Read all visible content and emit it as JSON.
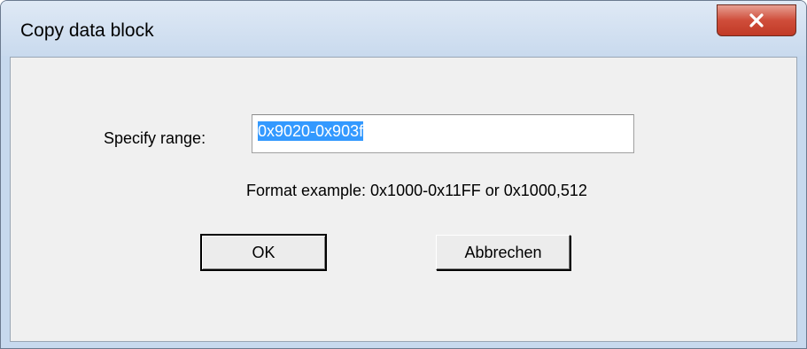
{
  "window": {
    "title": "Copy data block",
    "close_icon": "close-icon"
  },
  "form": {
    "range_label": "Specify range:",
    "range_value": "0x9020-0x903f",
    "format_example": "Format example: 0x1000-0x11FF or 0x1000,512"
  },
  "buttons": {
    "ok_label": "OK",
    "cancel_label": "Abbrechen"
  },
  "colors": {
    "selection": "#3399ff",
    "close_button": "#c7432e",
    "titlebar": "#c9daee",
    "client": "#f0f0f0"
  }
}
